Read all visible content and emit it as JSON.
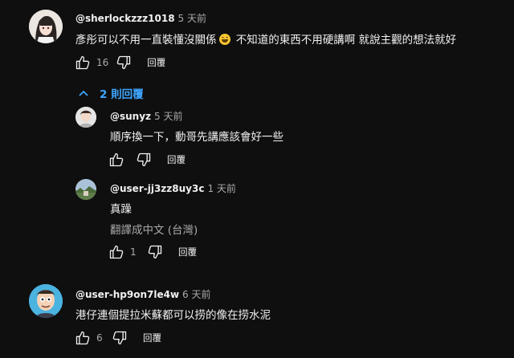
{
  "comments": [
    {
      "author": "@sherlockzzz1018",
      "time": "5 天前",
      "text_before_emoji": "彥彤可以不用一直裝懂沒關係",
      "text_after_emoji": " 不知道的東西不用硬講啊 就說主觀的想法就好",
      "likes": "16",
      "reply_label": "回覆"
    },
    {
      "author": "@user-hp9on7le4w",
      "time": "6 天前",
      "text": "港仔連個提拉米蘇都可以捞的像在捞水泥",
      "likes": "6",
      "reply_label": "回覆"
    }
  ],
  "replies_toggle": "2 則回覆",
  "replies": [
    {
      "author": "@sunyz",
      "time": "5 天前",
      "text": "順序換一下，動哥先講應該會好一些",
      "likes": "",
      "reply_label": "回覆"
    },
    {
      "author": "@user-jj3zz8uy3c",
      "time": "1 天前",
      "text": "真躁",
      "translate": "翻譯成中文 (台灣)",
      "likes": "1",
      "reply_label": "回覆"
    }
  ],
  "colors": {
    "background": "#0f0f0f",
    "link_blue": "#3ea6ff",
    "secondary_text": "#aaaaaa"
  }
}
